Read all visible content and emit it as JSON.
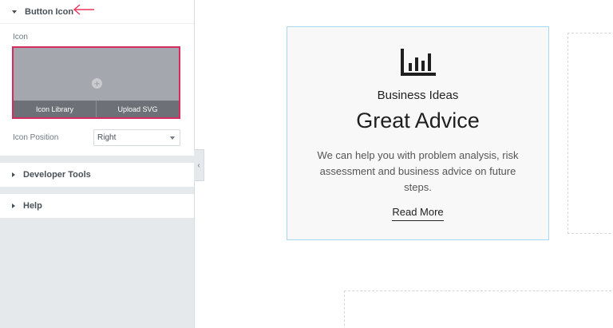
{
  "panel": {
    "button_icon_section": {
      "title": "Button Icon",
      "icon_label": "Icon",
      "icon_library_label": "Icon Library",
      "upload_svg_label": "Upload SVG",
      "icon_position_label": "Icon Position",
      "icon_position_value": "Right"
    },
    "developer_tools_title": "Developer Tools",
    "help_title": "Help",
    "collapse_glyph": "‹"
  },
  "card": {
    "subtitle": "Business Ideas",
    "title": "Great Advice",
    "text": "We can help you with problem analysis, risk assessment and business advice on future steps.",
    "button_label": "Read More",
    "icon": "bar-chart-icon"
  },
  "colors": {
    "accent_pink": "#d72b5f",
    "card_border": "#a8d8ef"
  }
}
